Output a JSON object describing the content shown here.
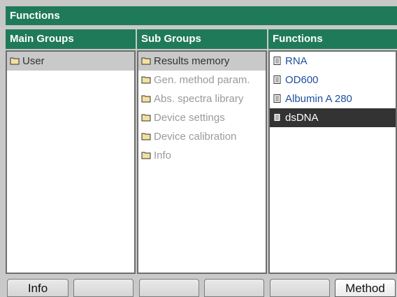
{
  "title": "Functions",
  "columns": {
    "main": "Main Groups",
    "sub": "Sub Groups",
    "functions": "Functions"
  },
  "main_groups": [
    "User"
  ],
  "sub_groups": [
    "Results memory",
    "Gen. method param.",
    "Abs. spectra library",
    "Device settings",
    "Device calibration",
    "Info"
  ],
  "functions_list": [
    "RNA",
    "OD600",
    "Albumin A 280",
    "dsDNA"
  ],
  "softkeys": [
    "Info",
    "",
    "",
    "",
    "",
    "Method"
  ],
  "colors": {
    "accent": "#1f7a5a",
    "selected_dark": "#333333",
    "link": "#1f4fa0"
  },
  "icons": {
    "group": "folder-icon",
    "function": "document-icon"
  }
}
